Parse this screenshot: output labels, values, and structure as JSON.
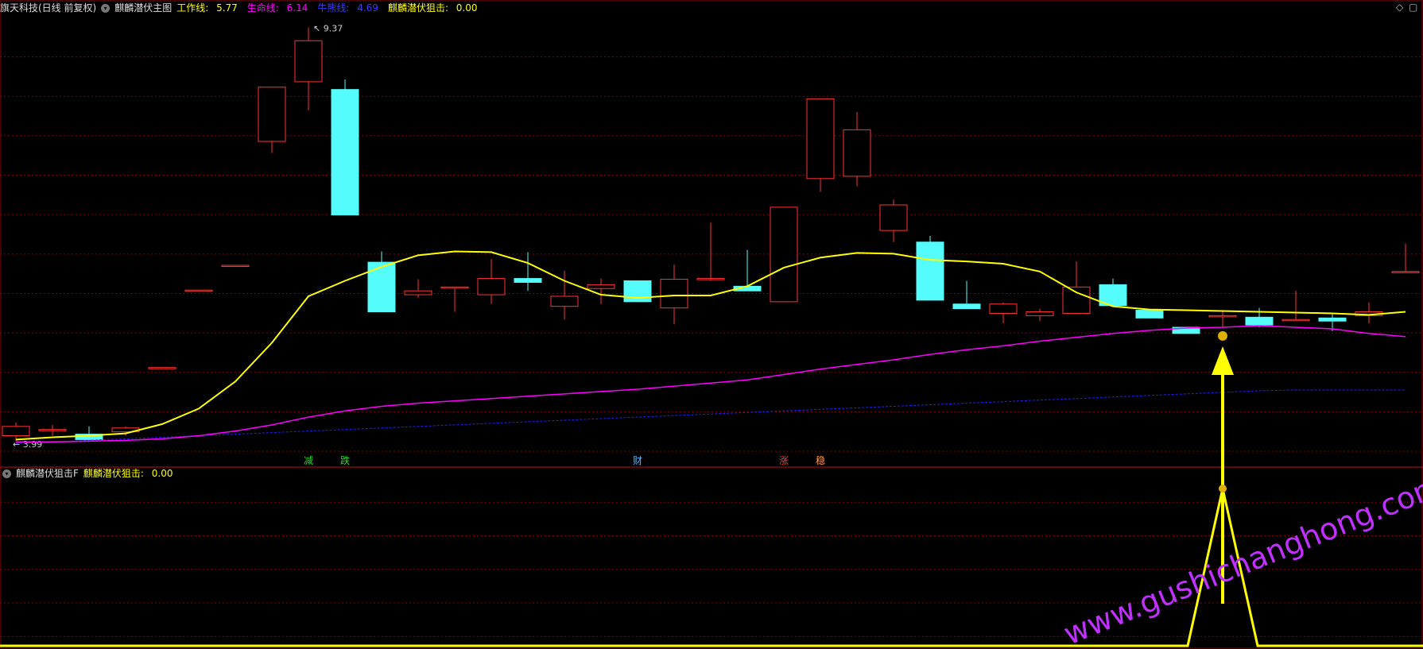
{
  "main_header": {
    "stock": "旗天科技(日线 前复权)",
    "indicator": "麒麟潜伏主图",
    "work_line_label": "工作线: ",
    "work_line_value": "5.77",
    "life_line_label": "生命线: ",
    "life_line_value": "6.14",
    "bull_line_label": "牛熊线: ",
    "bull_line_value": "4.69",
    "snipe_label": "麒麟潜伏狙击: ",
    "snipe_value": "0.00"
  },
  "sub_header": {
    "indicator": "麒麟潜伏狙击F",
    "snipe_label": "麒麟潜伏狙击: ",
    "snipe_value": "0.00"
  },
  "window_controls": {
    "diamond": "◇",
    "restore": "▢"
  },
  "watermark": "www.gushichanghong.com",
  "colors": {
    "up": "#ff3232",
    "down": "#54fcfc",
    "work": "#ffff00",
    "life": "#ff00ff",
    "bull": "#2020ff",
    "grid": "#8a0000",
    "arrow": "#ffff00"
  },
  "chart_data": {
    "type": "candlestick",
    "y_range": [
      3.9,
      9.5
    ],
    "high_label": "9.37",
    "low_label": "3.99",
    "candles": [
      {
        "o": 4.1,
        "h": 4.27,
        "l": 4.03,
        "c": 4.22
      },
      {
        "o": 4.18,
        "h": 4.24,
        "l": 4.1,
        "c": 4.18
      },
      {
        "o": 4.12,
        "h": 4.22,
        "l": 4.03,
        "c": 4.05
      },
      {
        "o": 4.15,
        "h": 4.22,
        "l": 4.1,
        "c": 4.2
      },
      {
        "o": 4.98,
        "h": 4.98,
        "l": 4.98,
        "c": 4.98
      },
      {
        "o": 5.98,
        "h": 5.98,
        "l": 5.98,
        "c": 5.98
      },
      {
        "o": 6.3,
        "h": 6.3,
        "l": 6.3,
        "c": 6.3
      },
      {
        "o": 7.9,
        "h": 8.6,
        "l": 7.75,
        "c": 8.6
      },
      {
        "o": 8.67,
        "h": 9.37,
        "l": 8.3,
        "c": 9.2
      },
      {
        "o": 8.57,
        "h": 8.7,
        "l": 6.95,
        "c": 6.95
      },
      {
        "o": 6.34,
        "h": 6.48,
        "l": 5.7,
        "c": 5.7
      },
      {
        "o": 5.92,
        "h": 6.12,
        "l": 5.88,
        "c": 5.97
      },
      {
        "o": 6.02,
        "h": 6.02,
        "l": 5.7,
        "c": 6.02
      },
      {
        "o": 5.92,
        "h": 6.38,
        "l": 5.8,
        "c": 6.13
      },
      {
        "o": 6.13,
        "h": 6.47,
        "l": 5.97,
        "c": 6.08
      },
      {
        "o": 5.77,
        "h": 6.23,
        "l": 5.6,
        "c": 5.9
      },
      {
        "o": 6.0,
        "h": 6.13,
        "l": 5.8,
        "c": 6.05
      },
      {
        "o": 6.1,
        "h": 6.1,
        "l": 5.83,
        "c": 5.83
      },
      {
        "o": 5.75,
        "h": 6.31,
        "l": 5.54,
        "c": 6.12
      },
      {
        "o": 6.13,
        "h": 6.85,
        "l": 6.1,
        "c": 6.13
      },
      {
        "o": 6.03,
        "h": 6.5,
        "l": 5.97,
        "c": 5.97
      },
      {
        "o": 5.83,
        "h": 6.15,
        "l": 5.83,
        "c": 7.05
      },
      {
        "o": 7.42,
        "h": 8.1,
        "l": 7.25,
        "c": 8.45
      },
      {
        "o": 7.45,
        "h": 8.28,
        "l": 7.32,
        "c": 8.05
      },
      {
        "o": 6.75,
        "h": 7.15,
        "l": 6.6,
        "c": 7.08
      },
      {
        "o": 6.6,
        "h": 6.68,
        "l": 5.85,
        "c": 5.85
      },
      {
        "o": 5.8,
        "h": 6.1,
        "l": 5.74,
        "c": 5.74
      },
      {
        "o": 5.68,
        "h": 5.82,
        "l": 5.55,
        "c": 5.8
      },
      {
        "o": 5.65,
        "h": 5.74,
        "l": 5.58,
        "c": 5.7
      },
      {
        "o": 5.68,
        "h": 6.35,
        "l": 5.67,
        "c": 6.02
      },
      {
        "o": 6.05,
        "h": 6.13,
        "l": 5.78,
        "c": 5.78
      },
      {
        "o": 5.72,
        "h": 5.72,
        "l": 5.62,
        "c": 5.62
      },
      {
        "o": 5.5,
        "h": 5.5,
        "l": 5.42,
        "c": 5.42
      },
      {
        "o": 5.65,
        "h": 5.7,
        "l": 5.5,
        "c": 5.65
      },
      {
        "o": 5.63,
        "h": 5.75,
        "l": 5.5,
        "c": 5.53
      },
      {
        "o": 5.6,
        "h": 5.97,
        "l": 5.6,
        "c": 5.6
      },
      {
        "o": 5.62,
        "h": 5.68,
        "l": 5.45,
        "c": 5.58
      },
      {
        "o": 5.65,
        "h": 5.82,
        "l": 5.55,
        "c": 5.7
      },
      {
        "o": 6.22,
        "h": 6.58,
        "l": 6.22,
        "c": 6.22
      }
    ],
    "work_line": [
      4.05,
      4.08,
      4.1,
      4.13,
      4.25,
      4.45,
      4.8,
      5.3,
      5.9,
      6.1,
      6.28,
      6.43,
      6.48,
      6.47,
      6.33,
      6.1,
      5.92,
      5.88,
      5.91,
      5.91,
      6.03,
      6.27,
      6.4,
      6.46,
      6.45,
      6.37,
      6.35,
      6.32,
      6.22,
      5.95,
      5.77,
      5.73,
      5.72,
      5.71,
      5.7,
      5.69,
      5.68,
      5.66,
      5.7
    ],
    "life_line": [
      4.02,
      4.02,
      4.03,
      4.04,
      4.06,
      4.1,
      4.16,
      4.24,
      4.34,
      4.42,
      4.48,
      4.52,
      4.55,
      4.58,
      4.61,
      4.64,
      4.67,
      4.7,
      4.74,
      4.78,
      4.82,
      4.89,
      4.96,
      5.02,
      5.08,
      5.15,
      5.21,
      5.26,
      5.32,
      5.37,
      5.42,
      5.46,
      5.49,
      5.5,
      5.52,
      5.5,
      5.48,
      5.42,
      5.38
    ],
    "bull_line": [
      4.0,
      4.02,
      4.04,
      4.06,
      4.08,
      4.1,
      4.12,
      4.14,
      4.16,
      4.18,
      4.2,
      4.22,
      4.24,
      4.26,
      4.28,
      4.3,
      4.32,
      4.34,
      4.36,
      4.38,
      4.4,
      4.42,
      4.44,
      4.46,
      4.48,
      4.5,
      4.52,
      4.54,
      4.56,
      4.58,
      4.6,
      4.62,
      4.64,
      4.66,
      4.68,
      4.69,
      4.69,
      4.69,
      4.69
    ],
    "markers": [
      {
        "i": 8,
        "text": "减",
        "color": "#22dd22"
      },
      {
        "i": 9,
        "text": "跌",
        "color": "#22dd22"
      },
      {
        "i": 17,
        "text": "财",
        "color": "#54b4ff"
      },
      {
        "i": 21,
        "text": "涨",
        "color": "#ff3232"
      },
      {
        "i": 22,
        "text": "稳",
        "color": "#ffa040"
      }
    ],
    "signal_index": 33,
    "sub_series": {
      "base": 0,
      "peak_index": 33,
      "peak": 1
    }
  }
}
